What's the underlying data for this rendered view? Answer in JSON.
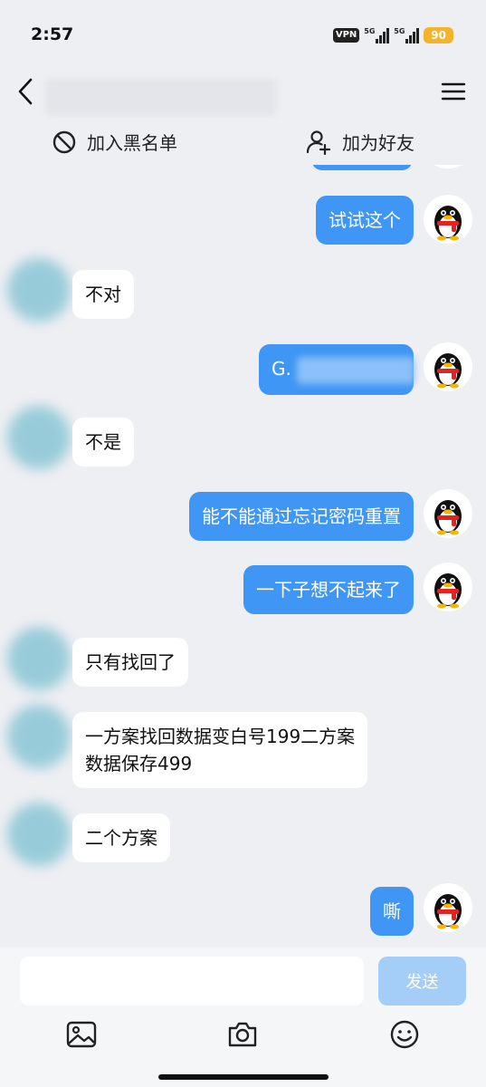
{
  "status": {
    "time": "2:57",
    "vpn": "VPN",
    "signal1": "5G",
    "signal2": "5G",
    "battery": "90"
  },
  "header": {
    "actions": {
      "block_label": "加入黑名单",
      "add_friend_label": "加为好友"
    }
  },
  "messages": [
    {
      "side": "out",
      "text": "试试这个"
    },
    {
      "side": "in",
      "text": "不对"
    },
    {
      "side": "out",
      "text": "G."
    },
    {
      "side": "in",
      "text": "不是"
    },
    {
      "side": "out",
      "text": "能不能通过忘记密码重置"
    },
    {
      "side": "out",
      "text": "一下子想不起来了"
    },
    {
      "side": "in",
      "text": "只有找回了"
    },
    {
      "side": "in",
      "line1": "一方案找回数据变白号199二方案",
      "line2": "数据保存499"
    },
    {
      "side": "in",
      "text": "二个方案"
    },
    {
      "side": "out",
      "text": "嘶"
    }
  ],
  "composer": {
    "input_value": "",
    "send_label": "发送"
  },
  "icons": {
    "back": "chevron-left-icon",
    "menu": "hamburger-menu-icon",
    "block": "block-icon",
    "add_friend": "add-user-icon",
    "image": "image-icon",
    "camera": "camera-icon",
    "emoji": "emoji-icon"
  },
  "colors": {
    "outgoing_bubble": "#3f96f4",
    "incoming_bubble": "#ffffff",
    "background": "#eeeff3",
    "send_button": "#a4cdf8"
  }
}
